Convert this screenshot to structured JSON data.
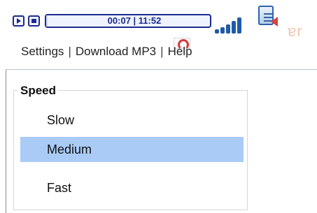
{
  "player": {
    "time": "00:07 | 11:52",
    "progress": 0.01,
    "volume_level": 5,
    "colors": {
      "accent": "#1b2a8f",
      "selected": "#a9cbf6"
    }
  },
  "menu": {
    "settings": "Settings",
    "sep1": "|",
    "download": "Download MP3",
    "sep2": "|",
    "help": "Help"
  },
  "speed": {
    "legend": "Speed",
    "options": [
      "Slow",
      "Medium",
      "Fast"
    ],
    "selected": "Medium"
  }
}
